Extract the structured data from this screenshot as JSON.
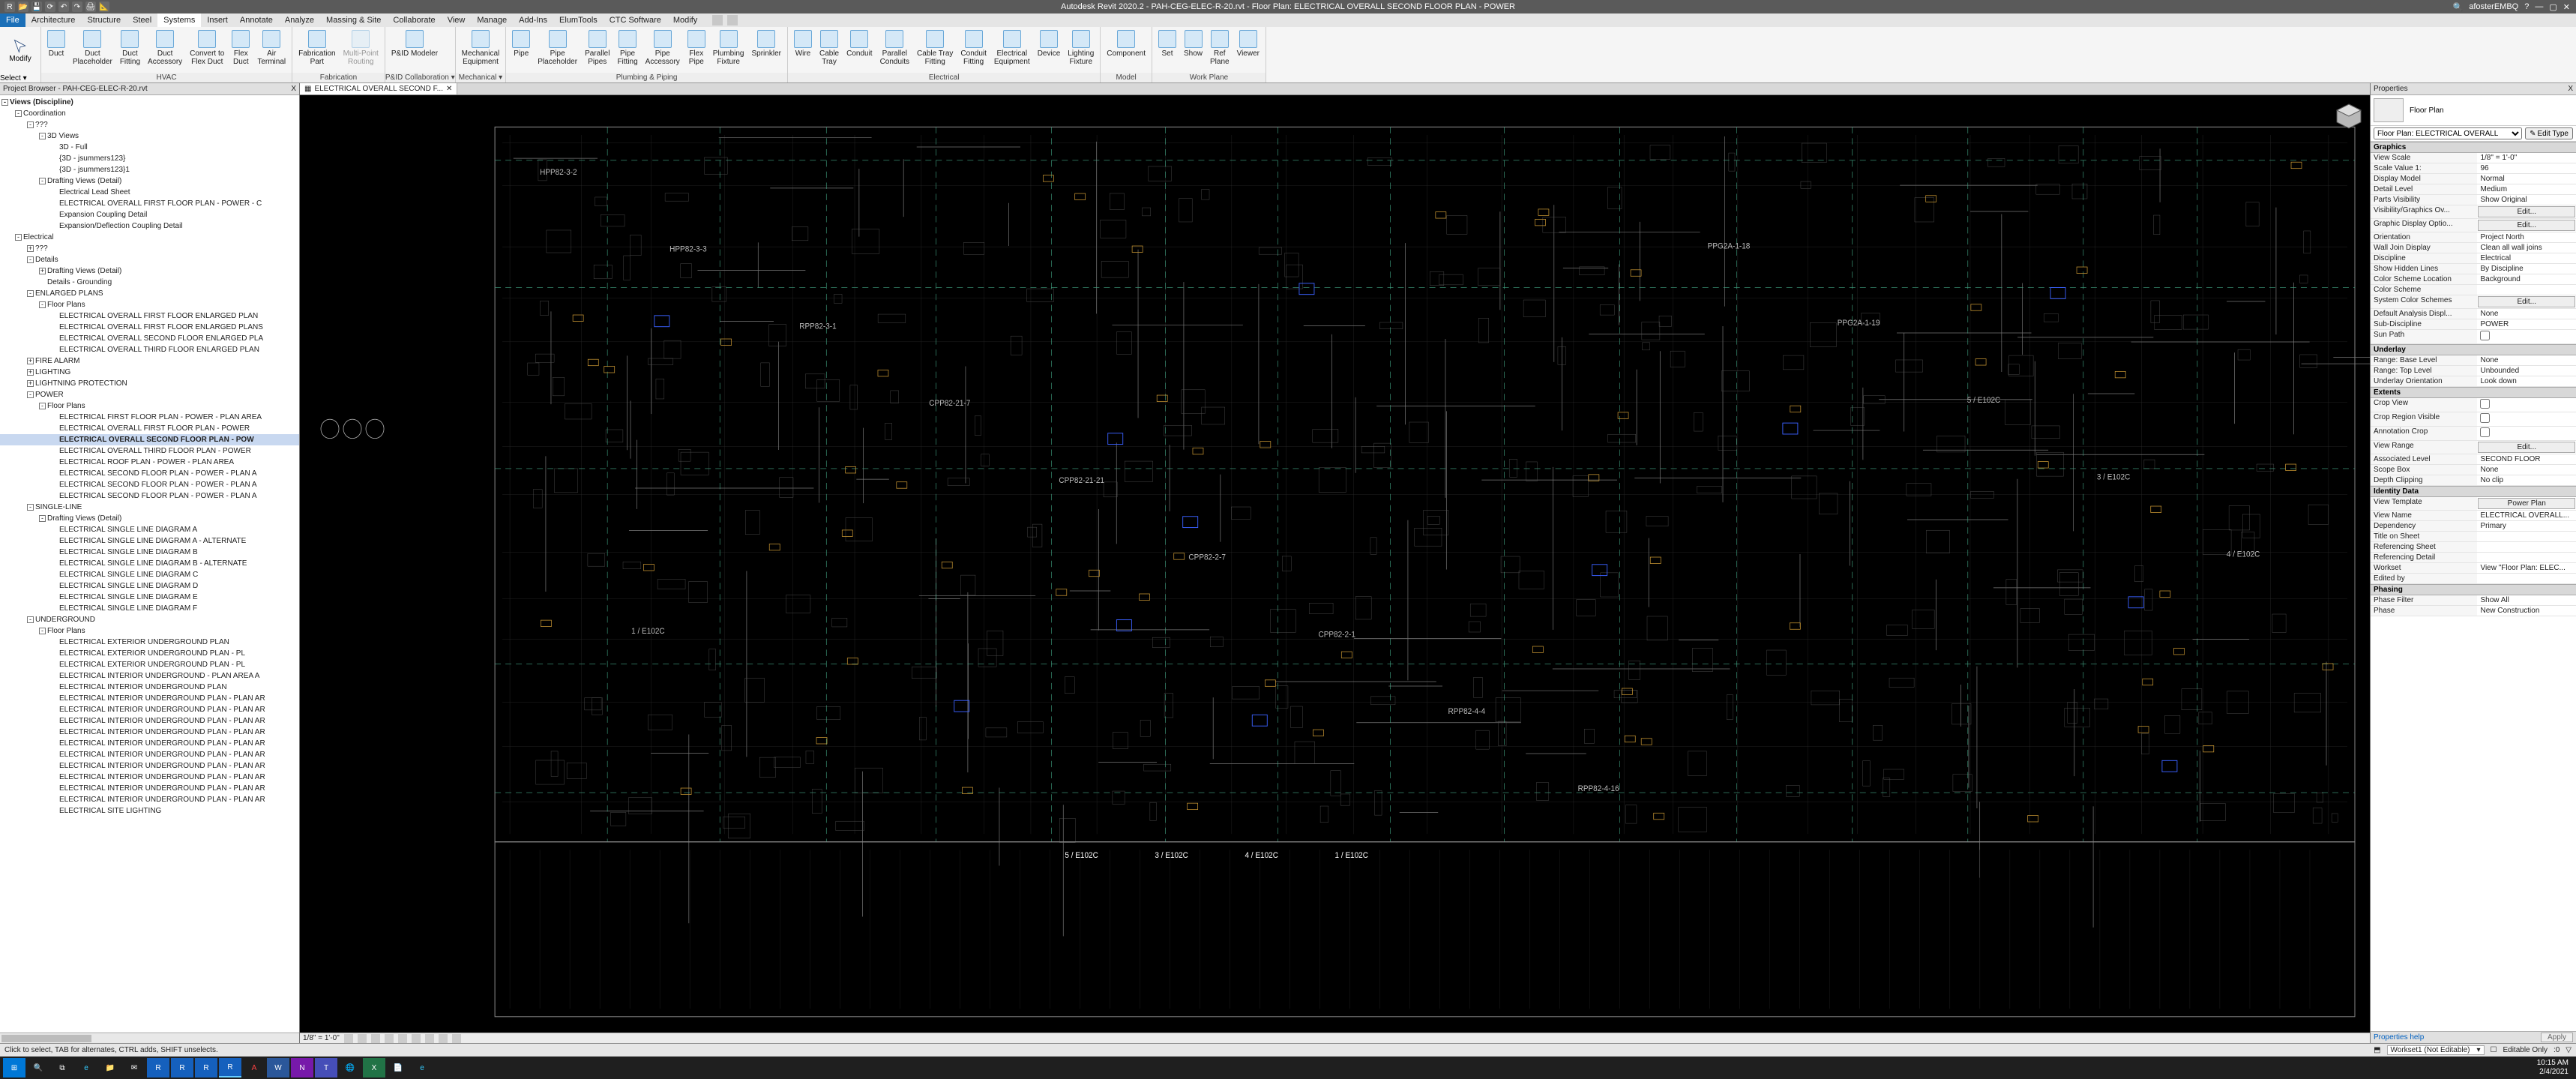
{
  "titlebar": {
    "title": "Autodesk Revit 2020.2 - PAH-CEG-ELEC-R-20.rvt - Floor Plan: ELECTRICAL OVERALL SECOND FLOOR PLAN - POWER",
    "user": "afosterEMBQ",
    "win_min": "—",
    "win_max": "▢",
    "win_close": "✕"
  },
  "menus": {
    "file": "File",
    "tabs": [
      "Architecture",
      "Structure",
      "Steel",
      "Systems",
      "Insert",
      "Annotate",
      "Analyze",
      "Massing & Site",
      "Collaborate",
      "View",
      "Manage",
      "Add-Ins",
      "ElumTools",
      "CTC Software",
      "Modify"
    ],
    "active": "Systems"
  },
  "ribbon": {
    "modify": "Modify",
    "select": "Select ▾",
    "hvac": {
      "title": "HVAC",
      "items": [
        {
          "l": "Duct"
        },
        {
          "l": "Duct\nPlaceholder"
        },
        {
          "l": "Duct\nFitting"
        },
        {
          "l": "Duct\nAccessory"
        },
        {
          "l": "Convert to\nFlex Duct"
        },
        {
          "l": "Flex\nDuct"
        },
        {
          "l": "Air\nTerminal"
        }
      ]
    },
    "fab": {
      "title": "Fabrication",
      "items": [
        {
          "l": "Fabrication\nPart"
        },
        {
          "l": "Multi-Point\nRouting",
          "d": true
        }
      ]
    },
    "pid": {
      "title": "P&ID Collaboration ▾",
      "items": [
        {
          "l": "P&ID Modeler"
        }
      ]
    },
    "mech": {
      "title": "Mechanical ▾",
      "items": [
        {
          "l": "Mechanical\nEquipment"
        }
      ]
    },
    "pp": {
      "title": "Plumbing & Piping",
      "items": [
        {
          "l": "Pipe"
        },
        {
          "l": "Pipe\nPlaceholder"
        },
        {
          "l": "Parallel\nPipes"
        },
        {
          "l": "Pipe\nFitting"
        },
        {
          "l": "Pipe\nAccessory"
        },
        {
          "l": "Flex\nPipe"
        },
        {
          "l": "Plumbing\nFixture"
        },
        {
          "l": "Sprinkler"
        }
      ]
    },
    "elec": {
      "title": "Electrical",
      "items": [
        {
          "l": "Wire"
        },
        {
          "l": "Cable\nTray"
        },
        {
          "l": "Conduit"
        },
        {
          "l": "Parallel\nConduits"
        },
        {
          "l": "Cable Tray\nFitting"
        },
        {
          "l": "Conduit\nFitting"
        },
        {
          "l": "Electrical\nEquipment"
        },
        {
          "l": "Device"
        },
        {
          "l": "Lighting\nFixture"
        }
      ]
    },
    "model": {
      "title": "Model",
      "items": [
        {
          "l": "Component"
        }
      ]
    },
    "wp": {
      "title": "Work Plane",
      "items": [
        {
          "l": "Set"
        },
        {
          "l": "Show"
        },
        {
          "l": "Ref\nPlane"
        },
        {
          "l": "Viewer"
        }
      ]
    }
  },
  "browser": {
    "title": "Project Browser - PAH-CEG-ELEC-R-20.rvt",
    "close": "X",
    "root": "Views (Discipline)",
    "nodes": [
      {
        "d": 1,
        "e": "-",
        "t": "Coordination"
      },
      {
        "d": 2,
        "e": "-",
        "t": "???"
      },
      {
        "d": 3,
        "e": "-",
        "t": "3D Views"
      },
      {
        "d": 4,
        "t": "3D - Full"
      },
      {
        "d": 4,
        "t": "{3D - jsummers123}"
      },
      {
        "d": 4,
        "t": "{3D - jsummers123}1"
      },
      {
        "d": 3,
        "e": "-",
        "t": "Drafting Views (Detail)"
      },
      {
        "d": 4,
        "t": "Electrical Lead Sheet"
      },
      {
        "d": 4,
        "t": "ELECTRICAL OVERALL FIRST FLOOR PLAN - POWER - C"
      },
      {
        "d": 4,
        "t": "Expansion Coupling Detail"
      },
      {
        "d": 4,
        "t": "Expansion/Deflection Coupling Detail"
      },
      {
        "d": 1,
        "e": "-",
        "t": "Electrical"
      },
      {
        "d": 2,
        "e": "+",
        "t": "???"
      },
      {
        "d": 2,
        "e": "-",
        "t": "Details"
      },
      {
        "d": 3,
        "e": "+",
        "t": "Drafting Views (Detail)"
      },
      {
        "d": 3,
        "t": "Details - Grounding"
      },
      {
        "d": 2,
        "e": "-",
        "t": "ENLARGED PLANS"
      },
      {
        "d": 3,
        "e": "-",
        "t": "Floor Plans"
      },
      {
        "d": 4,
        "t": "ELECTRICAL OVERALL FIRST FLOOR ENLARGED PLAN"
      },
      {
        "d": 4,
        "t": "ELECTRICAL OVERALL FIRST FLOOR ENLARGED PLANS"
      },
      {
        "d": 4,
        "t": "ELECTRICAL OVERALL SECOND FLOOR ENLARGED PLA"
      },
      {
        "d": 4,
        "t": "ELECTRICAL OVERALL THIRD FLOOR ENLARGED PLAN"
      },
      {
        "d": 2,
        "e": "+",
        "t": "FIRE ALARM"
      },
      {
        "d": 2,
        "e": "+",
        "t": "LIGHTING"
      },
      {
        "d": 2,
        "e": "+",
        "t": "LIGHTNING PROTECTION"
      },
      {
        "d": 2,
        "e": "-",
        "t": "POWER"
      },
      {
        "d": 3,
        "e": "-",
        "t": "Floor Plans"
      },
      {
        "d": 4,
        "t": "ELECTRICAL FIRST FLOOR PLAN - POWER - PLAN AREA"
      },
      {
        "d": 4,
        "t": "ELECTRICAL OVERALL FIRST FLOOR PLAN - POWER"
      },
      {
        "d": 4,
        "t": "ELECTRICAL OVERALL SECOND FLOOR PLAN - POW",
        "b": true,
        "s": true
      },
      {
        "d": 4,
        "t": "ELECTRICAL OVERALL THIRD FLOOR PLAN - POWER"
      },
      {
        "d": 4,
        "t": "ELECTRICAL ROOF PLAN - POWER - PLAN AREA"
      },
      {
        "d": 4,
        "t": "ELECTRICAL SECOND FLOOR PLAN - POWER - PLAN A"
      },
      {
        "d": 4,
        "t": "ELECTRICAL SECOND FLOOR PLAN - POWER - PLAN A"
      },
      {
        "d": 4,
        "t": "ELECTRICAL SECOND FLOOR PLAN - POWER - PLAN A"
      },
      {
        "d": 2,
        "e": "-",
        "t": "SINGLE-LINE"
      },
      {
        "d": 3,
        "e": "-",
        "t": "Drafting Views (Detail)"
      },
      {
        "d": 4,
        "t": "ELECTRICAL SINGLE LINE DIAGRAM A"
      },
      {
        "d": 4,
        "t": "ELECTRICAL SINGLE LINE DIAGRAM A - ALTERNATE"
      },
      {
        "d": 4,
        "t": "ELECTRICAL SINGLE LINE DIAGRAM B"
      },
      {
        "d": 4,
        "t": "ELECTRICAL SINGLE LINE DIAGRAM B - ALTERNATE"
      },
      {
        "d": 4,
        "t": "ELECTRICAL SINGLE LINE DIAGRAM C"
      },
      {
        "d": 4,
        "t": "ELECTRICAL SINGLE LINE DIAGRAM D"
      },
      {
        "d": 4,
        "t": "ELECTRICAL SINGLE LINE DIAGRAM E"
      },
      {
        "d": 4,
        "t": "ELECTRICAL SINGLE LINE DIAGRAM F"
      },
      {
        "d": 2,
        "e": "-",
        "t": "UNDERGROUND"
      },
      {
        "d": 3,
        "e": "-",
        "t": "Floor Plans"
      },
      {
        "d": 4,
        "t": "ELECTRICAL EXTERIOR UNDERGROUND PLAN"
      },
      {
        "d": 4,
        "t": "ELECTRICAL EXTERIOR UNDERGROUND PLAN - PL"
      },
      {
        "d": 4,
        "t": "ELECTRICAL EXTERIOR UNDERGROUND PLAN - PL"
      },
      {
        "d": 4,
        "t": "ELECTRICAL INTERIOR UNDERGROUND - PLAN AREA A"
      },
      {
        "d": 4,
        "t": "ELECTRICAL INTERIOR UNDERGROUND PLAN"
      },
      {
        "d": 4,
        "t": "ELECTRICAL INTERIOR UNDERGROUND PLAN - PLAN AR"
      },
      {
        "d": 4,
        "t": "ELECTRICAL INTERIOR UNDERGROUND PLAN - PLAN AR"
      },
      {
        "d": 4,
        "t": "ELECTRICAL INTERIOR UNDERGROUND PLAN - PLAN AR"
      },
      {
        "d": 4,
        "t": "ELECTRICAL INTERIOR UNDERGROUND PLAN - PLAN AR"
      },
      {
        "d": 4,
        "t": "ELECTRICAL INTERIOR UNDERGROUND PLAN - PLAN AR"
      },
      {
        "d": 4,
        "t": "ELECTRICAL INTERIOR UNDERGROUND PLAN - PLAN AR"
      },
      {
        "d": 4,
        "t": "ELECTRICAL INTERIOR UNDERGROUND PLAN - PLAN AR"
      },
      {
        "d": 4,
        "t": "ELECTRICAL INTERIOR UNDERGROUND PLAN - PLAN AR"
      },
      {
        "d": 4,
        "t": "ELECTRICAL INTERIOR UNDERGROUND PLAN - PLAN AR"
      },
      {
        "d": 4,
        "t": "ELECTRICAL INTERIOR UNDERGROUND PLAN - PLAN AR"
      },
      {
        "d": 4,
        "t": "ELECTRICAL SITE LIGHTING"
      }
    ]
  },
  "viewtab": {
    "label": "ELECTRICAL OVERALL SECOND F...",
    "close": "✕"
  },
  "viewctrl": {
    "scale": "1/8\" = 1'-0\""
  },
  "canvas_tags": [
    "HPP82-3-2",
    "HPP82-3-3",
    "RPP82-3-1",
    "CPP82-21-7",
    "CPP82-21-21",
    "CPP82-2-7",
    "CPP82-2-1",
    "RPP82-4-4",
    "RPP82-4-16",
    "PPG2A-1-18",
    "PPG2A-1-19",
    "5 / E102C",
    "3 / E102C",
    "4 / E102C",
    "1 / E102C"
  ],
  "properties": {
    "title": "Properties",
    "close": "X",
    "type": "Floor Plan",
    "selector": "Floor Plan: ELECTRICAL OVERALL",
    "edit_type": "Edit Type",
    "help": "Properties help",
    "apply": "Apply",
    "groups": [
      {
        "name": "Graphics",
        "rows": [
          {
            "k": "View Scale",
            "v": "1/8\" = 1'-0\""
          },
          {
            "k": "Scale Value    1:",
            "v": "96"
          },
          {
            "k": "Display Model",
            "v": "Normal"
          },
          {
            "k": "Detail Level",
            "v": "Medium"
          },
          {
            "k": "Parts Visibility",
            "v": "Show Original"
          },
          {
            "k": "Visibility/Graphics Ov...",
            "v": "Edit...",
            "btn": true
          },
          {
            "k": "Graphic Display Optio...",
            "v": "Edit...",
            "btn": true
          },
          {
            "k": "Orientation",
            "v": "Project North"
          },
          {
            "k": "Wall Join Display",
            "v": "Clean all wall joins"
          },
          {
            "k": "Discipline",
            "v": "Electrical"
          },
          {
            "k": "Show Hidden Lines",
            "v": "By Discipline"
          },
          {
            "k": "Color Scheme Location",
            "v": "Background"
          },
          {
            "k": "Color Scheme",
            "v": ""
          },
          {
            "k": "System Color Schemes",
            "v": "Edit...",
            "btn": true
          },
          {
            "k": "Default Analysis Displ...",
            "v": "None"
          },
          {
            "k": "Sub-Discipline",
            "v": "POWER"
          },
          {
            "k": "Sun Path",
            "v": "",
            "chk": false
          }
        ]
      },
      {
        "name": "Underlay",
        "rows": [
          {
            "k": "Range: Base Level",
            "v": "None"
          },
          {
            "k": "Range: Top Level",
            "v": "Unbounded"
          },
          {
            "k": "Underlay Orientation",
            "v": "Look down"
          }
        ]
      },
      {
        "name": "Extents",
        "rows": [
          {
            "k": "Crop View",
            "v": "",
            "chk": false
          },
          {
            "k": "Crop Region Visible",
            "v": "",
            "chk": false
          },
          {
            "k": "Annotation Crop",
            "v": "",
            "chk": false
          },
          {
            "k": "View Range",
            "v": "Edit...",
            "btn": true
          },
          {
            "k": "Associated Level",
            "v": "SECOND FLOOR"
          },
          {
            "k": "Scope Box",
            "v": "None"
          },
          {
            "k": "Depth Clipping",
            "v": "No clip"
          }
        ]
      },
      {
        "name": "Identity Data",
        "rows": [
          {
            "k": "View Template",
            "v": "Power Plan",
            "btn": true
          },
          {
            "k": "View Name",
            "v": "ELECTRICAL OVERALL..."
          },
          {
            "k": "Dependency",
            "v": "Primary"
          },
          {
            "k": "Title on Sheet",
            "v": ""
          },
          {
            "k": "Referencing Sheet",
            "v": ""
          },
          {
            "k": "Referencing Detail",
            "v": ""
          },
          {
            "k": "Workset",
            "v": "View \"Floor Plan: ELEC..."
          },
          {
            "k": "Edited by",
            "v": ""
          }
        ]
      },
      {
        "name": "Phasing",
        "rows": [
          {
            "k": "Phase Filter",
            "v": "Show All"
          },
          {
            "k": "Phase",
            "v": "New Construction"
          }
        ]
      }
    ]
  },
  "status": {
    "hint": "Click to select, TAB for alternates, CTRL adds, SHIFT unselects.",
    "workset": "Workset1 (Not Editable)",
    "editonly": "Editable Only",
    "sel": ":0"
  },
  "taskbar": {
    "time": "10:15 AM",
    "date": "2/4/2021"
  }
}
